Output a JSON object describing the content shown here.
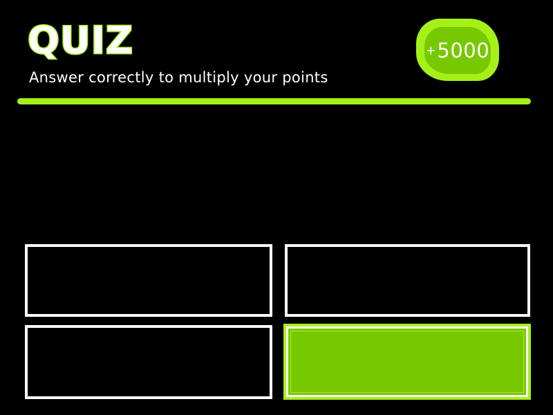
{
  "header": {
    "title": "QUIZ",
    "subtitle": "Answer correctly to multiply your points"
  },
  "score": {
    "prefix": "+",
    "value": "5000"
  },
  "answers": [
    {
      "label": "",
      "state": "default"
    },
    {
      "label": "",
      "state": "default"
    },
    {
      "label": "",
      "state": "default"
    },
    {
      "label": "",
      "state": "selected"
    }
  ],
  "colors": {
    "background": "#000000",
    "accent": "#a6f01a",
    "accent_dark": "#78c800",
    "text": "#ffffff",
    "answer_border": "#ffffff"
  }
}
